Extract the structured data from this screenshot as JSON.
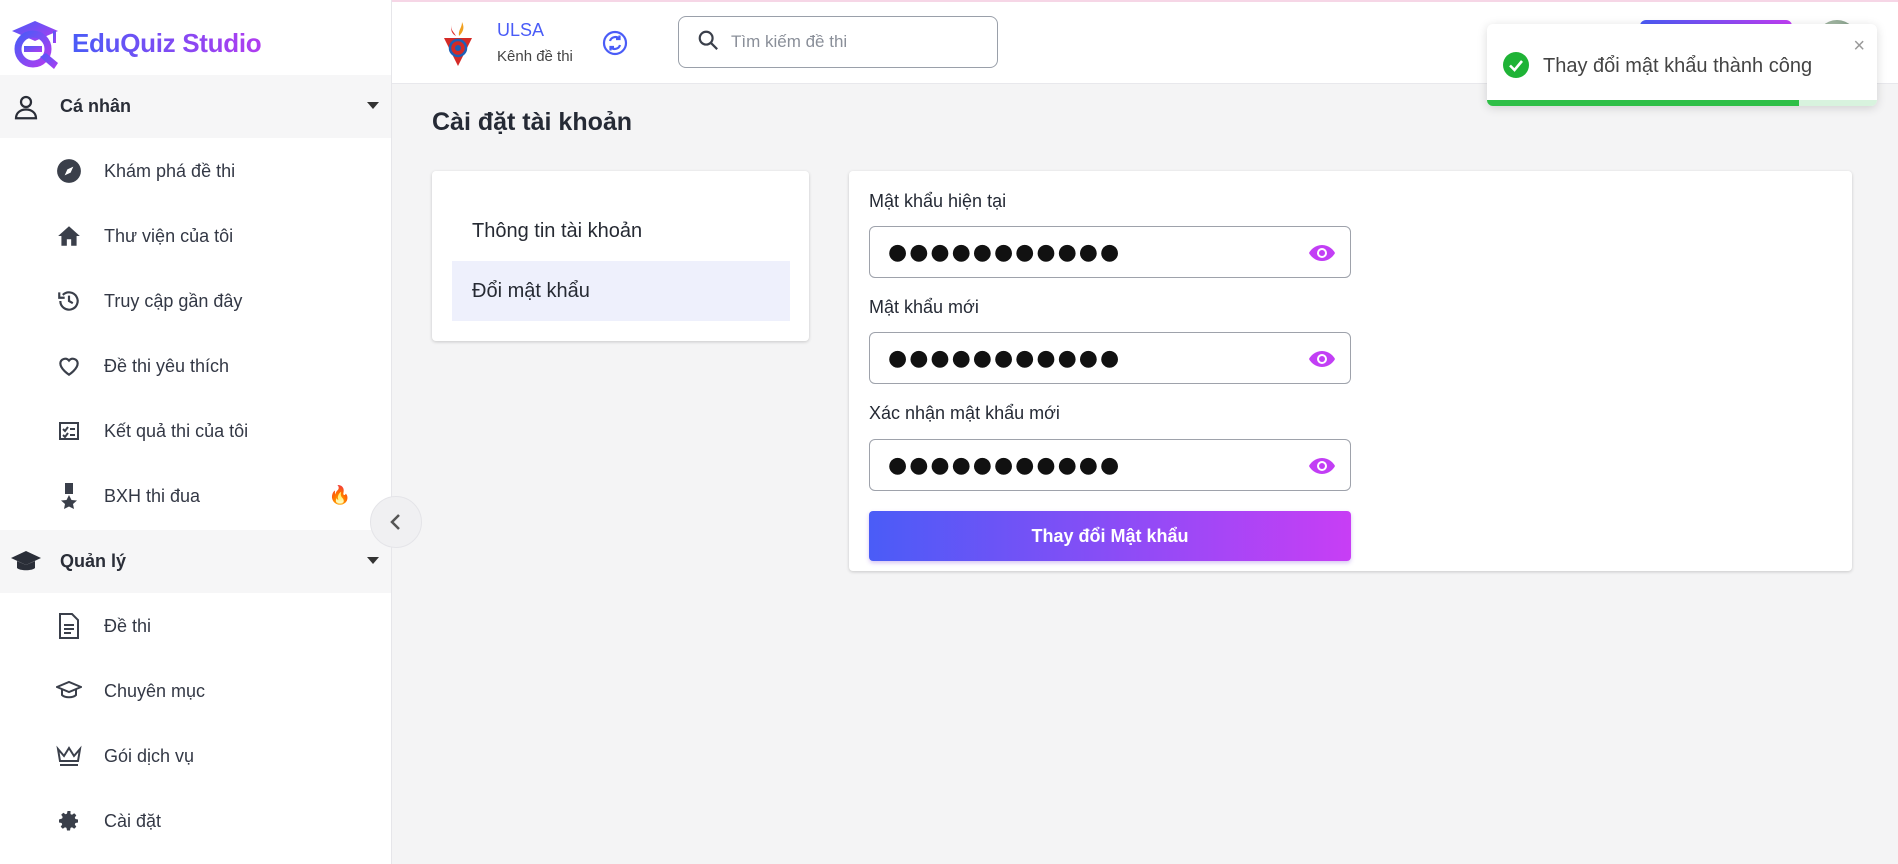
{
  "brand": {
    "name": "EduQuiz Studio"
  },
  "sidebar": {
    "personal": {
      "label": "Cá nhân"
    },
    "personal_items": [
      {
        "label": "Khám phá đề thi",
        "icon": "compass-icon"
      },
      {
        "label": "Thư viện của tôi",
        "icon": "home-icon"
      },
      {
        "label": "Truy cập gần đây",
        "icon": "history-icon"
      },
      {
        "label": "Đề thi yêu thích",
        "icon": "heart-icon"
      },
      {
        "label": "Kết quả thi của tôi",
        "icon": "checklist-icon"
      },
      {
        "label": "BXH thi đua",
        "icon": "medal-icon",
        "badge": "🔥"
      }
    ],
    "manage": {
      "label": "Quản lý"
    },
    "manage_items": [
      {
        "label": "Đề thi",
        "icon": "document-icon"
      },
      {
        "label": "Chuyên mục",
        "icon": "graduation-cap-icon"
      },
      {
        "label": "Gói dịch vụ",
        "icon": "crown-icon"
      },
      {
        "label": "Cài đặt",
        "icon": "gear-icon"
      }
    ]
  },
  "topbar": {
    "channel_name": "ULSA",
    "channel_sub": "Kênh đề thi",
    "search_placeholder": "Tìm kiếm đề thi"
  },
  "page": {
    "title": "Cài đặt tài khoản",
    "tabs": [
      {
        "label": "Thông tin tài khoản",
        "active": false
      },
      {
        "label": "Đổi mật khẩu",
        "active": true
      }
    ]
  },
  "form": {
    "current_label": "Mật khẩu hiện tại",
    "current_value": "●●●●●●●●●●●",
    "new_label": "Mật khẩu mới",
    "new_value": "●●●●●●●●●●●",
    "confirm_label": "Xác nhận mật khẩu mới",
    "confirm_value": "●●●●●●●●●●●",
    "submit_label": "Thay đổi Mật khẩu"
  },
  "toast": {
    "message": "Thay đổi mật khẩu thành công",
    "close": "×",
    "progress": 0.8
  },
  "colors": {
    "accent_start": "#4a5cf7",
    "accent_end": "#c83ef5",
    "success": "#2fbf47",
    "eye": "#c23ef5"
  }
}
